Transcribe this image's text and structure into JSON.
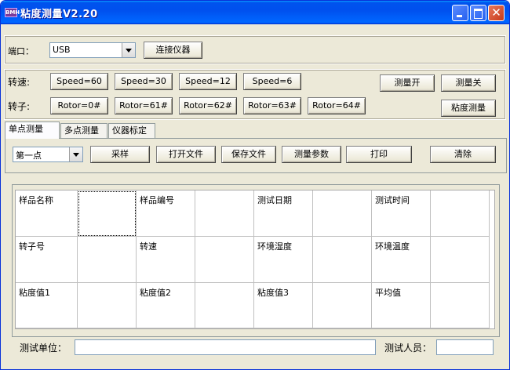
{
  "window": {
    "title": "粘度测量V2.20",
    "icon": "app-icon",
    "icon_text": "BMH"
  },
  "port": {
    "label": "端口：",
    "value": "USB",
    "connect_label": "连接仪器"
  },
  "speed": {
    "label": "转速:",
    "buttons": [
      "Speed=60",
      "Speed=30",
      "Speed=12",
      "Speed=6"
    ]
  },
  "rotor": {
    "label": "转子:",
    "buttons": [
      "Rotor=0#",
      "Rotor=61#",
      "Rotor=62#",
      "Rotor=63#",
      "Rotor=64#"
    ]
  },
  "measure": {
    "on_label": "测量开",
    "off_label": "测量关",
    "viscosity_label": "粘度测量"
  },
  "tabs": [
    "单点测量",
    "多点测量",
    "仪器标定"
  ],
  "toolbar": {
    "point_value": "第一点",
    "sample": "采样",
    "open_file": "打开文件",
    "save_file": "保存文件",
    "params": "测量参数",
    "print": "打印",
    "clear": "清除"
  },
  "grid": {
    "rows": [
      [
        "样品名称",
        "",
        "样品编号",
        "",
        "测试日期",
        "",
        "测试时间",
        ""
      ],
      [
        "转子号",
        "",
        "转速",
        "",
        "环境湿度",
        "",
        "环境温度",
        ""
      ],
      [
        "粘度值1",
        "",
        "粘度值2",
        "",
        "粘度值3",
        "",
        "平均值",
        ""
      ]
    ]
  },
  "footer": {
    "unit_label": "测试单位：",
    "unit_value": "",
    "person_label": "测试人员：",
    "person_value": ""
  }
}
